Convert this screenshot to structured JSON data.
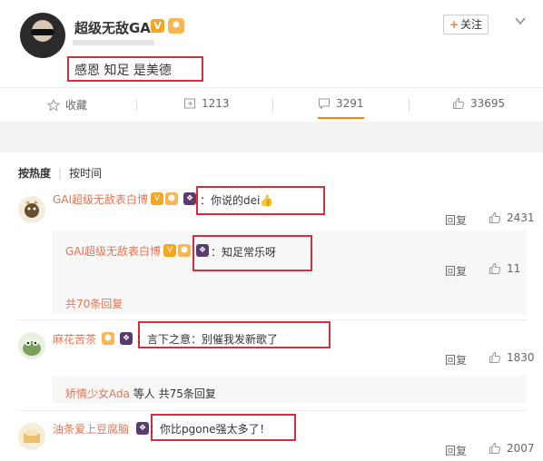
{
  "post": {
    "username": "超级无敌GAI",
    "verified_badge": "V",
    "text": "感恩 知足 是美德",
    "follow_label": "关注",
    "follow_plus": "+",
    "actions": {
      "favorite_label": "收藏",
      "repost_count": "1213",
      "comment_count": "3291",
      "like_count": "33695"
    }
  },
  "comments": {
    "sort_hot": "按热度",
    "sort_time": "按时间",
    "items": [
      {
        "name": "GAI超级无敌表白博",
        "text": "：你说的dei",
        "reply_label": "回复",
        "likes": "2431"
      },
      {
        "name": "GAI超级无敌表白博",
        "text": "：知足常乐呀",
        "reply_label": "回复",
        "likes": "11"
      },
      {
        "name": "麻花苦茶",
        "text": "：言下之意：别催我发新歌了",
        "reply_label": "回复",
        "likes": "1830"
      },
      {
        "name": "油条爱上豆腐脑",
        "text": "：你比pgone强太多了！",
        "reply_label": "回复",
        "likes": "2007"
      }
    ],
    "more_replies_1": "共70条回复",
    "more_replies_2_user": "矫情少女Ada",
    "more_replies_2_rest": " 等人 共75条回复"
  },
  "colors": {
    "accent": "#eb7350",
    "highlight_box": "#d32f3f",
    "follow_plus": "#f77c3d"
  },
  "icons": [
    "star-icon",
    "repost-icon",
    "comment-icon",
    "thumbs-up-icon",
    "chevron-down-icon",
    "thumbs-up-emoji"
  ]
}
